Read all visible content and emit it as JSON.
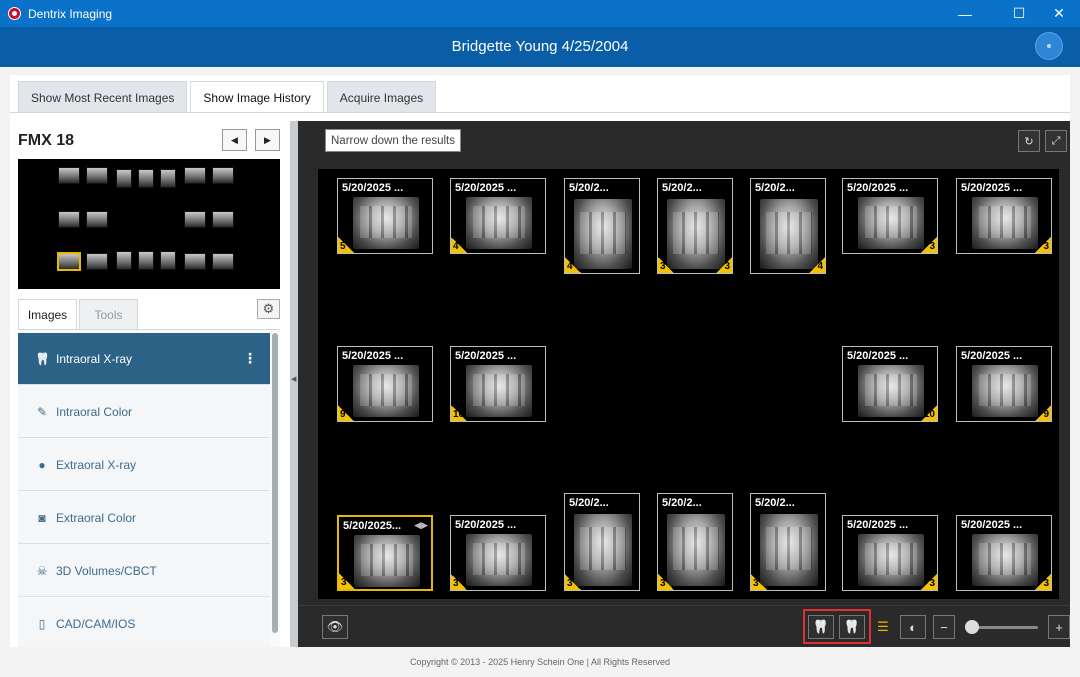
{
  "window": {
    "title": "Dentrix Imaging",
    "minimize": "—",
    "maximize": "☐",
    "close": "✕"
  },
  "header": {
    "patient": "Bridgette Young 4/25/2004"
  },
  "tabs": [
    {
      "label": "Show Most Recent Images"
    },
    {
      "label": "Show Image History"
    },
    {
      "label": "Acquire Images"
    }
  ],
  "left": {
    "title": "FMX 18",
    "prev": "◀",
    "next": "▶",
    "subtabs": [
      {
        "label": "Images"
      },
      {
        "label": "Tools"
      }
    ],
    "settings_icon": "⚙",
    "categories": [
      {
        "label": "Intraoral X-ray",
        "icon": "🦷",
        "menu": "⋮"
      },
      {
        "label": "Intraoral Color",
        "icon": "✎"
      },
      {
        "label": "Extraoral X-ray",
        "icon": "●"
      },
      {
        "label": "Extraoral Color",
        "icon": "◙"
      },
      {
        "label": "3D Volumes/CBCT",
        "icon": "☠"
      },
      {
        "label": "CAD/CAM/IOS",
        "icon": "▯"
      }
    ]
  },
  "viewer": {
    "filter_placeholder": "Narrow down the results",
    "refresh_icon": "↻",
    "expand_icon": "⤢",
    "images": [
      {
        "date": "5/20/2025 ...",
        "left": "5"
      },
      {
        "date": "5/20/2025 ...",
        "left": "4"
      },
      {
        "date": "5/20/2...",
        "left": "4"
      },
      {
        "date": "5/20/2...",
        "left": "3",
        "right": "3"
      },
      {
        "date": "5/20/2...",
        "right": "4"
      },
      {
        "date": "5/20/2025 ...",
        "right": "3"
      },
      {
        "date": "5/20/2025 ...",
        "right": "3"
      },
      {
        "date": "5/20/2025 ...",
        "left": "9"
      },
      {
        "date": "5/20/2025 ...",
        "left": "10"
      },
      {
        "date": "5/20/2025 ...",
        "right": "10"
      },
      {
        "date": "5/20/2025 ...",
        "right": "9"
      },
      {
        "date": "5/20/2025...",
        "left": "3",
        "arrows": "◀▶"
      },
      {
        "date": "5/20/2025 ...",
        "left": "3"
      },
      {
        "date": "5/20/2...",
        "left": "3"
      },
      {
        "date": "5/20/2...",
        "left": "3"
      },
      {
        "date": "5/20/2...",
        "left": "3"
      },
      {
        "date": "5/20/2025 ...",
        "right": "3"
      },
      {
        "date": "5/20/2025 ...",
        "right": "3"
      }
    ],
    "toolbar": {
      "eye_icon": "👁",
      "maxillary_icon": "🦷",
      "mandibular_icon": "🦷",
      "adjust_icon": "☰",
      "contrast_icon": "◐",
      "zoom_out": "−",
      "zoom_in": "+",
      "zoom_level": 0.0
    }
  },
  "footer": {
    "copyright": "Copyright © 2013 - 2025 Henry Schein One | All Rights Reserved"
  },
  "colors": {
    "titlebar": "#0b72c9",
    "header": "#0a5ea8",
    "active_category": "#2b6286",
    "badge": "#f2c200",
    "selection": "#e6b800",
    "highlight": "#e03030"
  }
}
